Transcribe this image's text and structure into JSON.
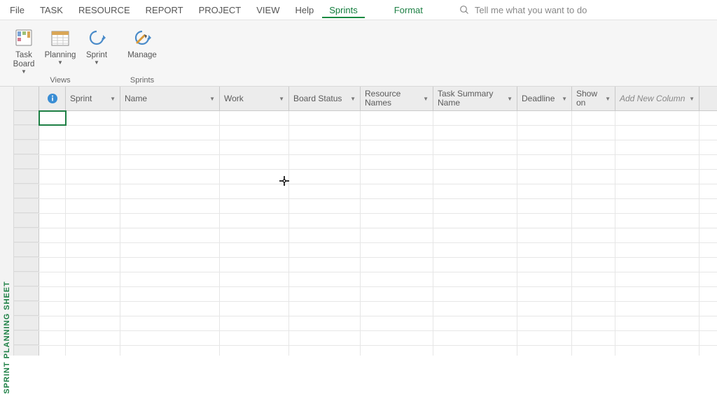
{
  "menu": {
    "file": "File",
    "task": "TASK",
    "resource": "RESOURCE",
    "report": "REPORT",
    "project": "PROJECT",
    "view": "VIEW",
    "help": "Help",
    "sprints": "Sprints",
    "format": "Format"
  },
  "search": {
    "placeholder": "Tell me what you want to do"
  },
  "ribbon": {
    "views_label": "Views",
    "sprints_label": "Sprints",
    "task_board": "Task Board",
    "planning": "Planning",
    "sprint": "Sprint",
    "manage": "Manage"
  },
  "sheet": {
    "title": "SPRINT PLANNING SHEET",
    "columns": {
      "info": "",
      "sprint": "Sprint",
      "name": "Name",
      "work": "Work",
      "board_status": "Board Status",
      "resource_names": "Resource Names",
      "task_summary_name": "Task Summary Name",
      "deadline": "Deadline",
      "show_on": "Show on",
      "add_new": "Add New Column"
    },
    "col_widths": {
      "info": 38,
      "sprint": 78,
      "name": 142,
      "work": 99,
      "board_status": 102,
      "resource_names": 104,
      "task_summary_name": 120,
      "deadline": 78,
      "show_on": 62,
      "add_new": 120
    }
  }
}
